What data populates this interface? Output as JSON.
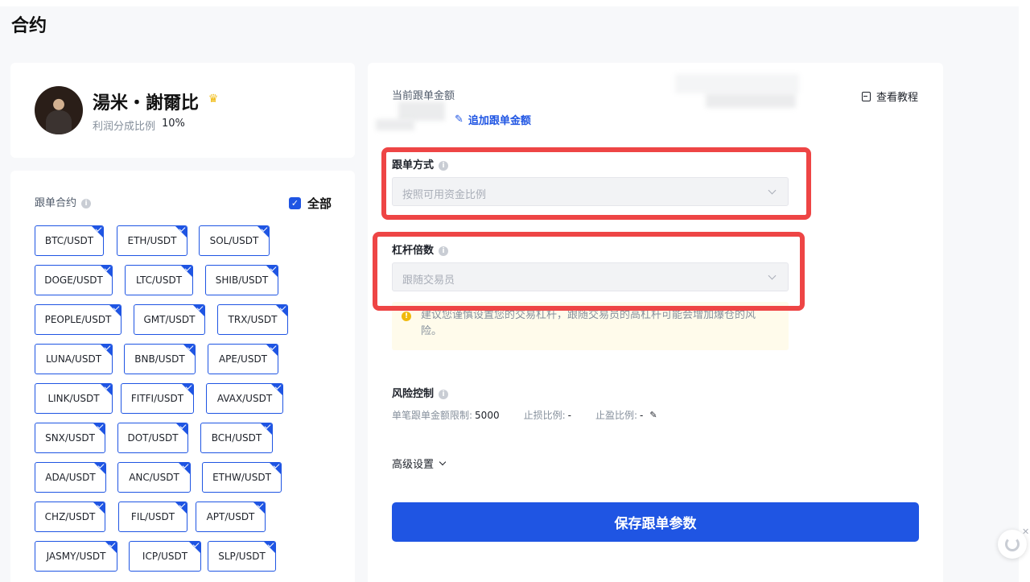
{
  "page": {
    "title": "合约"
  },
  "trader": {
    "name": "湯米・謝爾比",
    "profit_share_label": "利润分成比例",
    "profit_share_value": "10%"
  },
  "contracts": {
    "label": "跟单合约",
    "all_label": "全部",
    "all_checked": true,
    "items": [
      "BTC/USDT",
      "ETH/USDT",
      "SOL/USDT",
      "DOGE/USDT",
      "LTC/USDT",
      "SHIB/USDT",
      "PEOPLE/USDT",
      "GMT/USDT",
      "TRX/USDT",
      "LUNA/USDT",
      "BNB/USDT",
      "APE/USDT",
      "LINK/USDT",
      "FITFI/USDT",
      "AVAX/USDT",
      "SNX/USDT",
      "DOT/USDT",
      "BCH/USDT",
      "ADA/USDT",
      "ANC/USDT",
      "ETHW/USDT",
      "CHZ/USDT",
      "FIL/USDT",
      "APT/USDT",
      "JASMY/USDT",
      "ICP/USDT",
      "SLP/USDT"
    ]
  },
  "amount": {
    "label": "当前跟单金额",
    "add_label": "追加跟单金额",
    "tutorial_label": "查看教程"
  },
  "copy_mode": {
    "label": "跟单方式",
    "value": "按照可用资金比例"
  },
  "leverage": {
    "label": "杠杆倍数",
    "value": "跟随交易员",
    "warning": "建议您谨慎设置您的交易杠杆，跟随交易员的高杠杆可能会增加爆仓的风险。"
  },
  "risk": {
    "label": "风险控制",
    "single_limit_label": "单笔跟单金额限制:",
    "single_limit_value": "5000",
    "stop_loss_label": "止损比例:",
    "stop_loss_value": "-",
    "take_profit_label": "止盈比例:",
    "take_profit_value": "-"
  },
  "advanced": {
    "label": "高级设置"
  },
  "save_button": {
    "label": "保存跟单参数"
  },
  "colors": {
    "accent": "#1f55e3",
    "highlight": "#ee4545",
    "warning_bg": "#fffbeb"
  }
}
